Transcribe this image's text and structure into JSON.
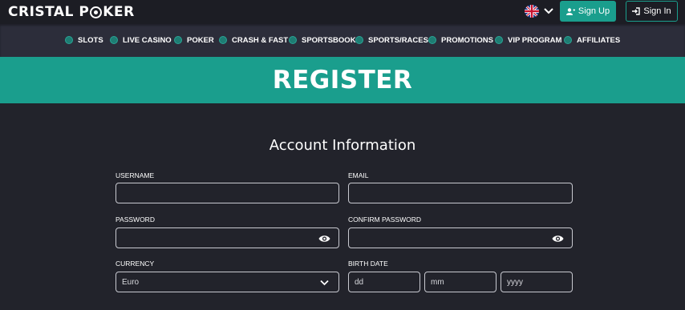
{
  "header": {
    "logo_text": "CRISTAL POKER",
    "language_flag": "uk-flag",
    "signup_label": "Sign Up",
    "signin_label": "Sign In"
  },
  "nav": {
    "items": [
      {
        "label": "SLOTS",
        "icon": "slots-icon"
      },
      {
        "label": "LIVE CASINO",
        "icon": "live-casino-icon"
      },
      {
        "label": "POKER",
        "icon": "poker-icon"
      },
      {
        "label": "CRASH & FAST",
        "icon": "crash-icon"
      },
      {
        "label": "SPORTSBOOK",
        "icon": "sportsbook-icon"
      },
      {
        "label": "SPORTS/RACES",
        "icon": "races-icon"
      },
      {
        "label": "PROMOTIONS",
        "icon": "promotions-icon"
      },
      {
        "label": "VIP PROGRAM",
        "icon": "vip-icon"
      },
      {
        "label": "AFFILIATES",
        "icon": "affiliates-icon"
      }
    ]
  },
  "banner": {
    "title": "REGISTER"
  },
  "form": {
    "section_title": "Account Information",
    "username_label": "USERNAME",
    "email_label": "EMAIL",
    "password_label": "PASSWORD",
    "confirm_password_label": "CONFIRM PASSWORD",
    "currency_label": "CURRENCY",
    "currency_value": "Euro",
    "birth_date_label": "BIRTH DATE",
    "birth_day_placeholder": "dd",
    "birth_month_placeholder": "mm",
    "birth_year_placeholder": "yyyy"
  },
  "colors": {
    "accent": "#1a9e8d",
    "background": "#22232b",
    "topbar": "#1c1d24",
    "navbar": "#2c2d3a"
  }
}
